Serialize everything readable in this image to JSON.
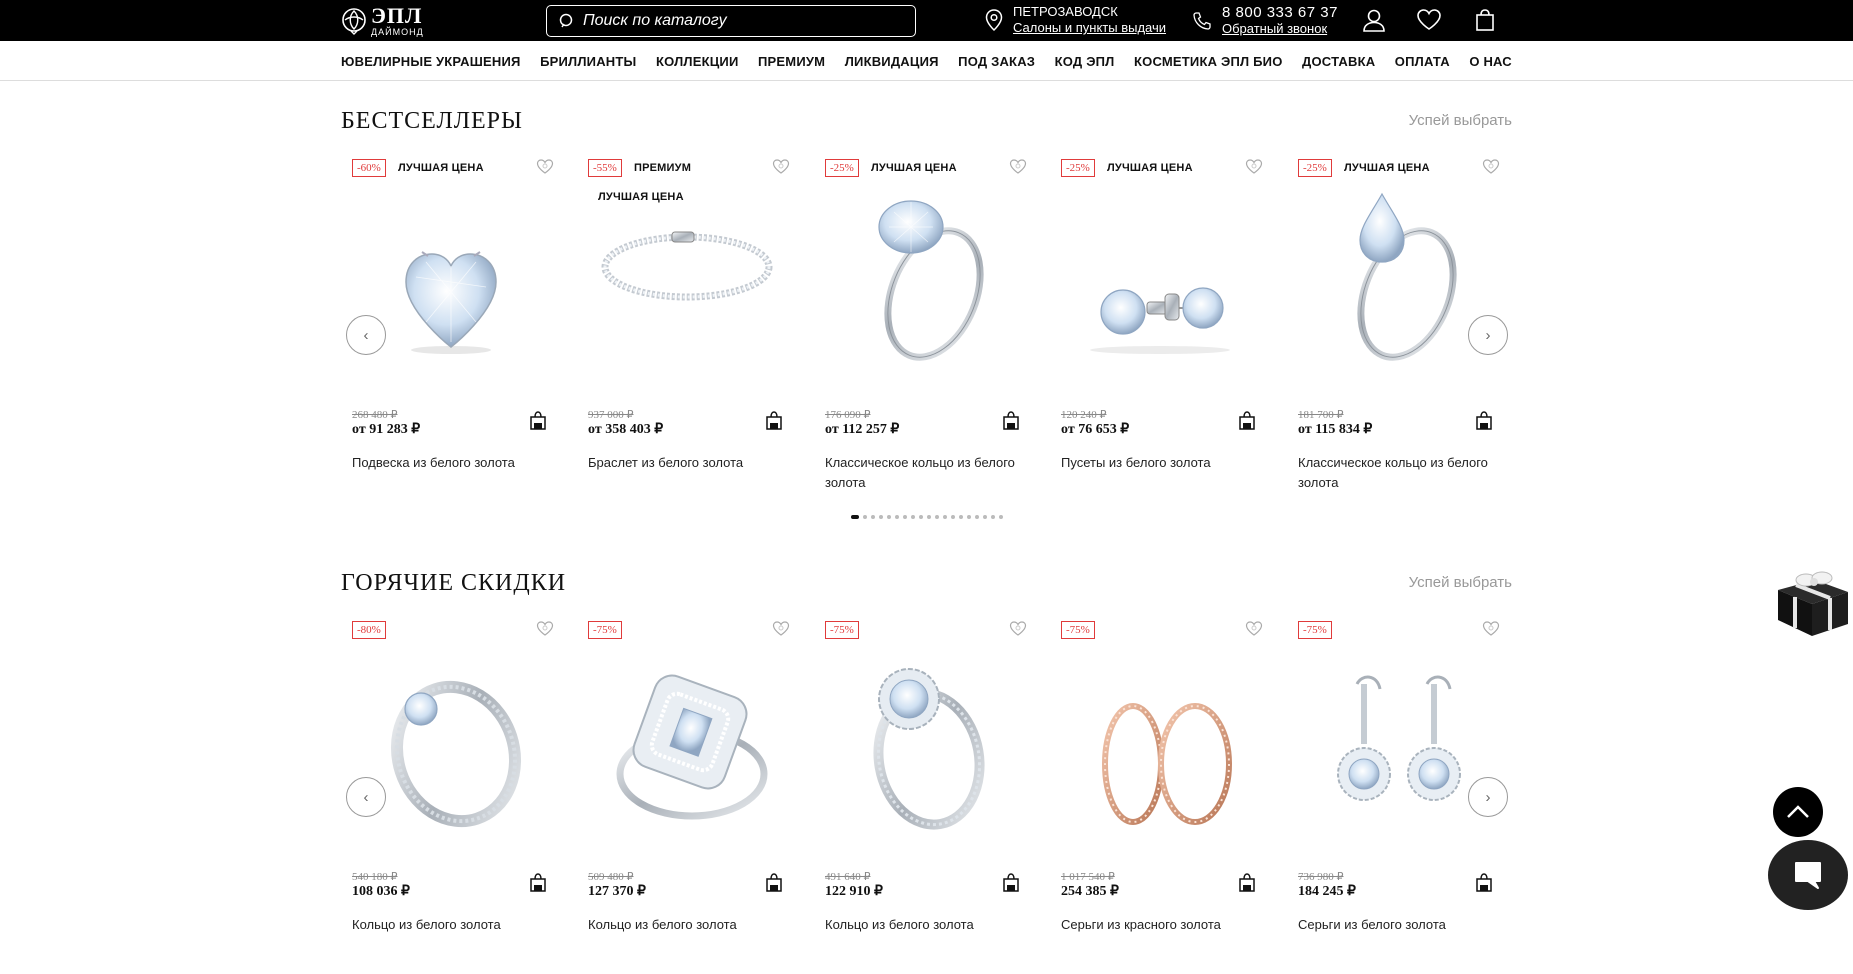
{
  "header": {
    "logo_line1": "ЭПЛ",
    "logo_line2": "ДАЙМОНД",
    "search_placeholder": "Поиск по каталогу",
    "city": "ПЕТРОЗАВОДСК",
    "salons_link": "Салоны и пункты выдачи",
    "phone": "8 800 333 67 37",
    "callback_link": "Обратный звонок"
  },
  "nav": [
    "ЮВЕЛИРНЫЕ УКРАШЕНИЯ",
    "БРИЛЛИАНТЫ",
    "КОЛЛЕКЦИИ",
    "ПРЕМИУМ",
    "ЛИКВИДАЦИЯ",
    "ПОД ЗАКАЗ",
    "КОД ЭПЛ",
    "КОСМЕТИКА ЭПЛ БИО",
    "ДОСТАВКА",
    "ОПЛАТА",
    "О НАС"
  ],
  "bestsellers": {
    "title": "БЕСТСЕЛЛЕРЫ",
    "link": "Успей выбрать",
    "products": [
      {
        "discount": "-60%",
        "label": "ЛУЧШАЯ ЦЕНА",
        "label2": "",
        "old_price": "268 480 ₽",
        "price": "от 91 283 ₽",
        "name": "Подвеска из белого золота",
        "image": "heart-pendant"
      },
      {
        "discount": "-55%",
        "label": "ПРЕМИУМ",
        "label2": "ЛУЧШАЯ ЦЕНА",
        "old_price": "937 000 ₽",
        "price": "от 358 403 ₽",
        "name": "Браслет из белого золота",
        "image": "tennis-bracelet"
      },
      {
        "discount": "-25%",
        "label": "ЛУЧШАЯ ЦЕНА",
        "label2": "",
        "old_price": "176 090 ₽",
        "price": "от 112 257 ₽",
        "name": "Классическое кольцо из белого золота",
        "image": "solitaire-ring-oval"
      },
      {
        "discount": "-25%",
        "label": "ЛУЧШАЯ ЦЕНА",
        "label2": "",
        "old_price": "120 240 ₽",
        "price": "от 76 653 ₽",
        "name": "Пусеты из белого золота",
        "image": "stud-earrings"
      },
      {
        "discount": "-25%",
        "label": "ЛУЧШАЯ ЦЕНА",
        "label2": "",
        "old_price": "181 700 ₽",
        "price": "от 115 834 ₽",
        "name": "Классическое кольцо из белого золота",
        "image": "solitaire-ring-pear"
      }
    ],
    "dots_total": 19,
    "dots_active": 0
  },
  "hot": {
    "title": "ГОРЯЧИЕ СКИДКИ",
    "link": "Успей выбрать",
    "products": [
      {
        "discount": "-80%",
        "old_price": "540 180 ₽",
        "price": "108 036 ₽",
        "name": "Кольцо из белого золота",
        "image": "ring-pave"
      },
      {
        "discount": "-75%",
        "old_price": "509 480 ₽",
        "price": "127 370 ₽",
        "name": "Кольцо из белого золота",
        "image": "ring-emerald-halo"
      },
      {
        "discount": "-75%",
        "old_price": "491 640 ₽",
        "price": "122 910 ₽",
        "name": "Кольцо из белого золота",
        "image": "ring-halo"
      },
      {
        "discount": "-75%",
        "old_price": "1 017 540 ₽",
        "price": "254 385 ₽",
        "name": "Серьги из красного золота",
        "image": "hoop-earrings-rose"
      },
      {
        "discount": "-75%",
        "old_price": "736 980 ₽",
        "price": "184 245 ₽",
        "name": "Серьги из белого золота",
        "image": "drop-earrings"
      }
    ]
  },
  "colors": {
    "accent_red": "#e03b3b",
    "header_bg": "#000000",
    "muted": "#999999"
  }
}
